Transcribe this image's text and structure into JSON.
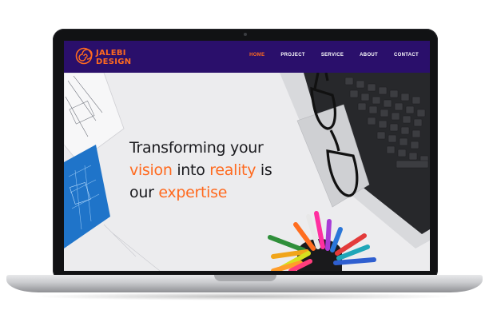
{
  "brand": {
    "line1": "JALEBI",
    "line2": "DESIGN",
    "accent": "#ff6a1f",
    "nav_bg": "#2a0f6b"
  },
  "nav": {
    "items": [
      {
        "label": "HOME",
        "active": true
      },
      {
        "label": "PROJECT",
        "active": false
      },
      {
        "label": "SERVICE",
        "active": false
      },
      {
        "label": "ABOUT",
        "active": false
      },
      {
        "label": "CONTACT",
        "active": false
      }
    ]
  },
  "hero": {
    "line1": "Transforming your",
    "line2_a": "vision",
    "line2_b": " into ",
    "line2_c": "reality",
    "line2_d": " is",
    "line3_a": "our ",
    "line3_b": "expertise"
  },
  "icons": [
    "spiral-logo-icon"
  ]
}
